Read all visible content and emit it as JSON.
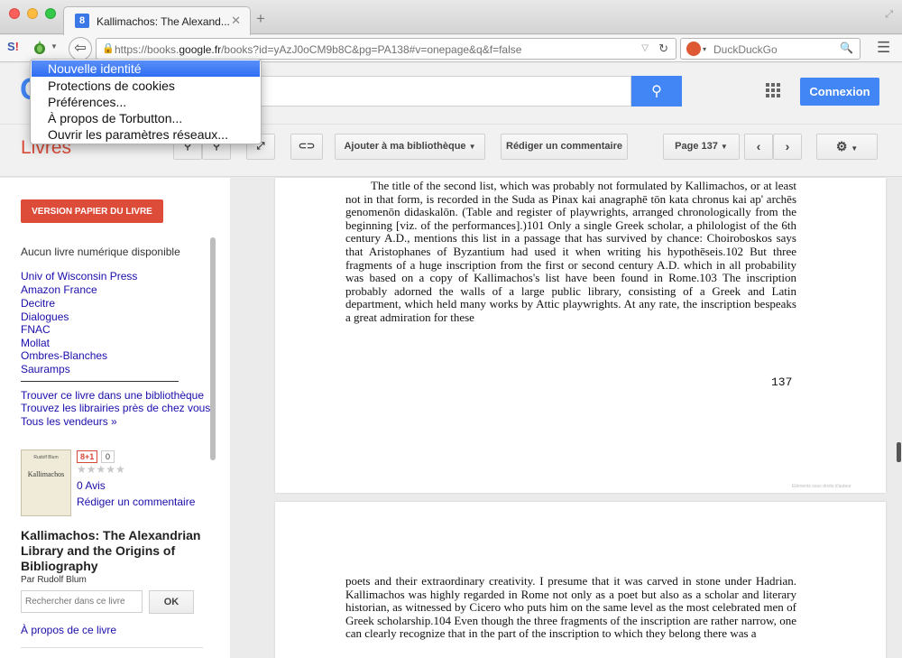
{
  "browser": {
    "tab_title": "Kallimachos: The Alexand...",
    "tab_close": "✕",
    "new_tab": "+",
    "url_prefix": "https://books.",
    "url_domain": "google.fr",
    "url_rest": "/books?id=yAzJ0oCM9b8C&pg=PA138#v=onepage&q&f=false",
    "search_engine": "DuckDuckGo",
    "colors": {
      "accent": "#4285f4",
      "red": "#dd4b39"
    }
  },
  "torbutton_menu": {
    "items": [
      {
        "label": "Nouvelle identité",
        "selected": true
      },
      {
        "label": "Protections de cookies",
        "selected": false
      },
      {
        "label": "Préférences...",
        "selected": false
      },
      {
        "label": "À propos de Torbutton...",
        "selected": false
      },
      {
        "label": "Ouvrir les paramètres réseaux...",
        "selected": false
      }
    ]
  },
  "google": {
    "signin_label": "Connexion"
  },
  "toolbar": {
    "section_title": "Livres",
    "add_library_label": "Ajouter à ma bibliothèque",
    "write_review_label": "Rédiger un commentaire",
    "page_selector": "Page 137"
  },
  "sidebar": {
    "print_version_label": "VERSION PAPIER DU LIVRE",
    "no_ebook": "Aucun livre numérique disponible",
    "sellers": [
      "Univ of Wisconsin Press",
      "Amazon France",
      "Decitre",
      "Dialogues",
      "FNAC",
      "Mollat",
      "Ombres-Blanches",
      "Sauramps"
    ],
    "find_library": "Trouver ce livre dans une bibliothèque",
    "find_bookstores": "Trouvez les librairies près de chez vous",
    "all_sellers": "Tous les vendeurs »",
    "gplus_label": "8+1",
    "gplus_count": "0",
    "stars": "★★★★★",
    "reviews_count": "0 Avis",
    "write_review": "Rédiger un commentaire",
    "book_title": "Kallimachos: The Alexandrian Library and the Origins of Bibliography",
    "author": "Par Rudolf Blum",
    "search_placeholder": "Rechercher dans ce livre",
    "ok_label": "OK",
    "about_book": "À propos de ce livre",
    "cover_author": "Rudolf Blum",
    "cover_title": "Kallimachos"
  },
  "reader": {
    "page_number": "137",
    "page1_text": "The title of the second list, which was probably not formulated by Kallimachos, or at least not in that form, is recorded in the Suda as Pinax kai anagraphē tōn kata chronus kai ap' archēs genomenōn didaskalōn. (Table and register of playwrights, arranged chronologically from the beginning [viz. of the performances].)101 Only a single Greek scholar, a philologist of the 6th century A.D., mentions this list in a passage that has survived by chance: Choiroboskos says that Aristophanes of Byzantium had used it when writing his hypothēseis.102 But three fragments of a huge inscription from the first or second century A.D. which in all probability was based on a copy of Kallimachos's list have been found in Rome.103 The inscription probably adorned the walls of a large public library, consisting of a Greek and Latin department, which held many works by Attic playwrights. At any rate, the inscription bespeaks a great admiration for these",
    "page2_text": "poets and their extraordinary creativity. I presume that it was carved in stone under Hadrian. Kallimachos was highly regarded in Rome not only as a poet but also as a scholar and literary historian, as witnessed by Cicero who puts him on the same level as the most celebrated men of Greek scholarship.104 Even though the three fragments of the inscription are rather narrow, one can clearly recognize that in the part of the inscription to which they belong there was a",
    "copyright_note": "Éléments sous droits d'auteur"
  }
}
